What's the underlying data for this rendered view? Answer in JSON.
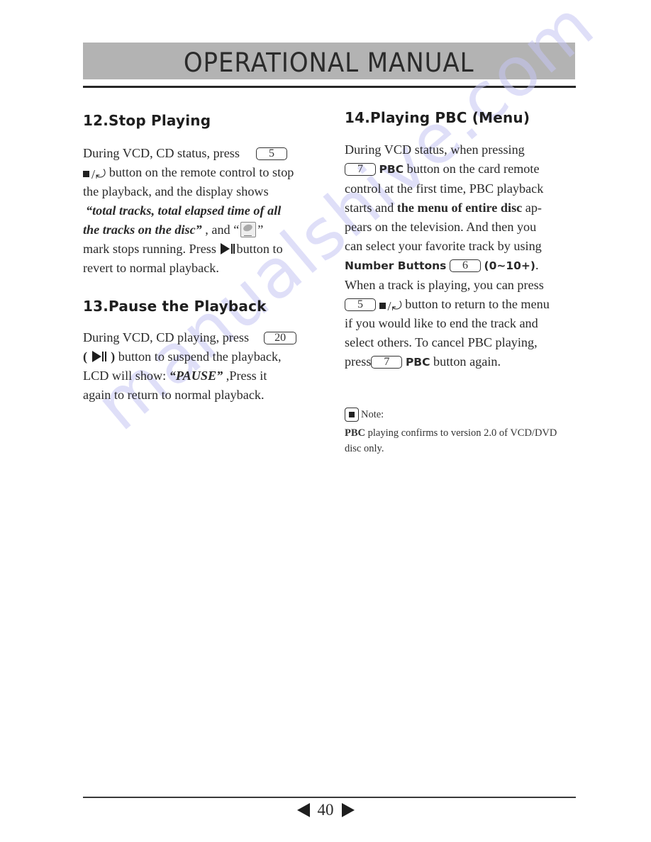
{
  "header": {
    "title": "OPERATIONAL MANUAL"
  },
  "watermark": {
    "text": "manualshive.com",
    "color": "#c6c6f4"
  },
  "sections": {
    "s12": {
      "heading": "12.Stop Playing",
      "line1_text": "During VCD, CD status, press",
      "line1_key": "5",
      "line2_text": " button on the remote control to stop",
      "line3_text": "the playback, and the display shows",
      "quote_open": "“",
      "quote_text": "total tracks, total elapsed time of all",
      "quote_text2": "the tracks on the disc",
      "quote_close": "”",
      "and_text": " , and “",
      "and_close": "”",
      "line5_text": "mark stops running. Press",
      "line5_after": "button to",
      "line6_text": "revert to normal playback."
    },
    "s13": {
      "heading": "13.Pause the Playback",
      "line1_text": "During VCD, CD playing, press",
      "line1_key": "20",
      "line2_open": "(",
      "line2_close": ")",
      "line2_text": " button to suspend  the playback,",
      "line3_text": "LCD will show: ",
      "pause_quote_open": "“",
      "pause_word": "PAUSE",
      "pause_quote_close": "”",
      "line3_after": " ,Press it",
      "line4_text": "again to return to normal playback."
    },
    "s14": {
      "heading": "14.Playing PBC (Menu)",
      "line1_text": "During VCD status, when pressing",
      "line2_key": "7",
      "line2_bold": "PBC",
      "line2_text": " button on the card remote",
      "line3_text": "control at the first time, PBC playback",
      "line4_text": "starts and ",
      "line4_bold": "the menu of entire disc",
      "line4_after": " ap-",
      "line5_text": "pears on the television. And then you",
      "line6_text": "can select your favorite track by using",
      "line7_bold": "Number Buttons",
      "line7_key": "6",
      "line7_after": "(0~10+)",
      "line7_period": ".",
      "line8_text": "When a track is playing, you can press",
      "line9_key": "5",
      "line9_text": " button to return to the menu",
      "line10_text": "if you would like to end the track and",
      "line11_text": "select others. To cancel PBC playing,",
      "line12_text": "press",
      "line12_key": "7",
      "line12_bold": "PBC",
      "line12_after": " button again."
    }
  },
  "note": {
    "label": "Note:",
    "bold": "PBC",
    "text1": " playing confirms to version 2.0 of VCD/DVD",
    "text2": "disc only."
  },
  "icons": {
    "stop_return": "stop-return-icon",
    "play_pause": "play-pause-icon",
    "disc": "disc-running-icon",
    "note": "note-icon",
    "prev": "prev-page-icon",
    "next": "next-page-icon"
  },
  "footer": {
    "page_number": "40"
  }
}
